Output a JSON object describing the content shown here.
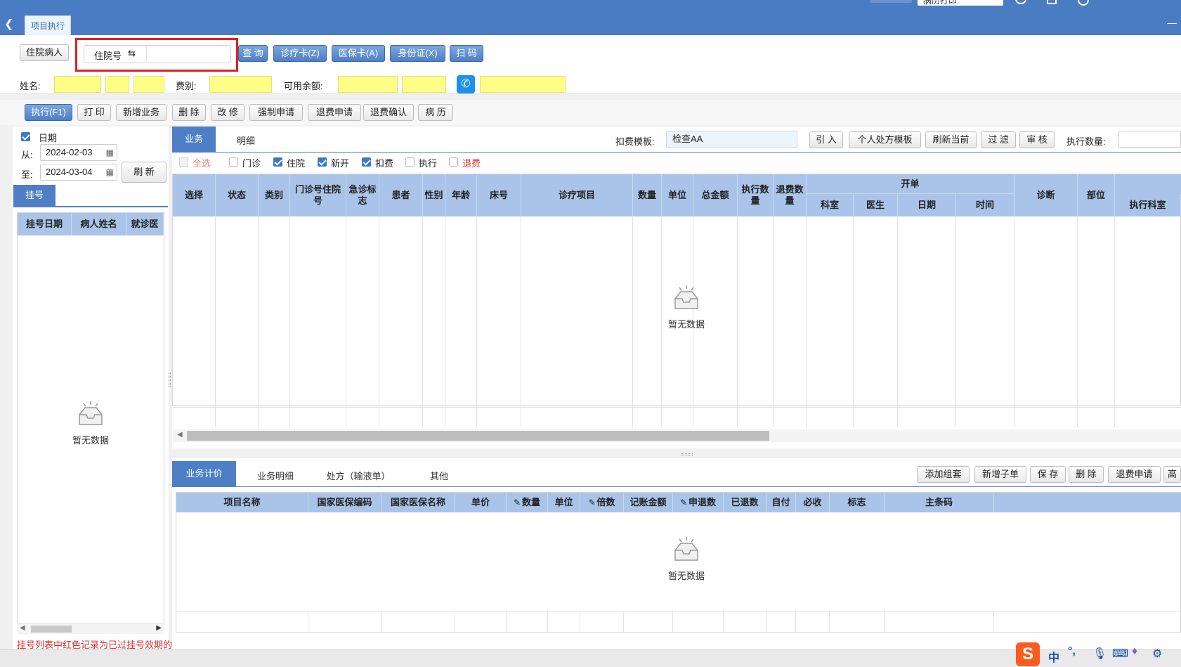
{
  "topbar": {
    "field_value": "病历打印"
  },
  "tab": {
    "label": "项目执行"
  },
  "search": {
    "patient_type_button": "住院病人",
    "id_type_label": "住院号",
    "id_type_icon": "switch-icon",
    "input_value": "",
    "query_button": "查 询",
    "card_button": "诊疗卡(Z)",
    "insurance_button": "医保卡(A)",
    "idcard_button": "身份证(X)",
    "scan_button": "扫 码"
  },
  "patient": {
    "name_label": "姓名:",
    "fee_type_label": "费别:",
    "balance_label": "可用余额:"
  },
  "toolbar": {
    "execute": "执行(F1)",
    "print": "打 印",
    "add_business": "新增业务",
    "delete": "删 除",
    "modify": "改 修",
    "force_apply": "强制申请",
    "refund_apply": "退费申请",
    "refund_confirm": "退费确认",
    "medical_record": "病 历"
  },
  "left": {
    "date_label": "日期",
    "from_label": "从:",
    "from_value": "2024-02-03",
    "to_label": "至:",
    "to_value": "2024-03-04",
    "refresh": "刷 新",
    "register_tab": "挂号",
    "columns": [
      "挂号日期",
      "病人姓名",
      "就诊医"
    ],
    "empty_text": "暂无数据",
    "footer_note": "挂号列表中红色记录为已过挂号效期的记录"
  },
  "main": {
    "tabs": [
      "业务",
      "明细"
    ],
    "template_label": "扣费模板:",
    "template_value": "检查AA",
    "buttons": [
      "引 入",
      "个人处方模板",
      "刷新当前",
      "过 滤",
      "审 核"
    ],
    "exec_qty_label": "执行数量:",
    "filters": [
      {
        "label": "全选",
        "checked": false,
        "color": "#e03030",
        "disabled": true
      },
      {
        "label": "门诊",
        "checked": false,
        "color": "#222222"
      },
      {
        "label": "住院",
        "checked": true,
        "color": "#222222"
      },
      {
        "label": "新开",
        "checked": true,
        "color": "#222222"
      },
      {
        "label": "扣费",
        "checked": true,
        "color": "#222222"
      },
      {
        "label": "执行",
        "checked": false,
        "color": "#222222"
      },
      {
        "label": "退费",
        "checked": false,
        "color": "#e03030"
      }
    ],
    "columns": [
      "选择",
      "状态",
      "类别",
      "门诊号住院号",
      "急诊标志",
      "患者",
      "性别",
      "年龄",
      "床号",
      "诊疗项目",
      "数量",
      "单位",
      "总金额",
      "执行数量",
      "退费数量",
      "诊断",
      "部位"
    ],
    "group_header": "开单",
    "group_columns": [
      "科室",
      "医生",
      "日期",
      "时间"
    ],
    "exec_dept": "执行科室",
    "empty_text": "暂无数据"
  },
  "bottom": {
    "tabs": [
      "业务计价",
      "业务明细",
      "处方（输液单）",
      "其他"
    ],
    "buttons": [
      "添加组套",
      "新增子单",
      "保 存",
      "删 除",
      "退费申请",
      "高"
    ],
    "columns": [
      "项目名称",
      "国家医保编码",
      "国家医保名称",
      "单价",
      "数量",
      "单位",
      "倍数",
      "记账金额",
      "申退数",
      "已退数",
      "自付",
      "必收",
      "标志",
      "主条码"
    ],
    "empty_text": "暂无数据"
  },
  "ime": {
    "lang": "中",
    "punct": "°,"
  },
  "colors": {
    "accent": "#4a7cc4",
    "header": "#a9c4e8",
    "highlight": "#ffff88",
    "alert": "#e03030"
  }
}
